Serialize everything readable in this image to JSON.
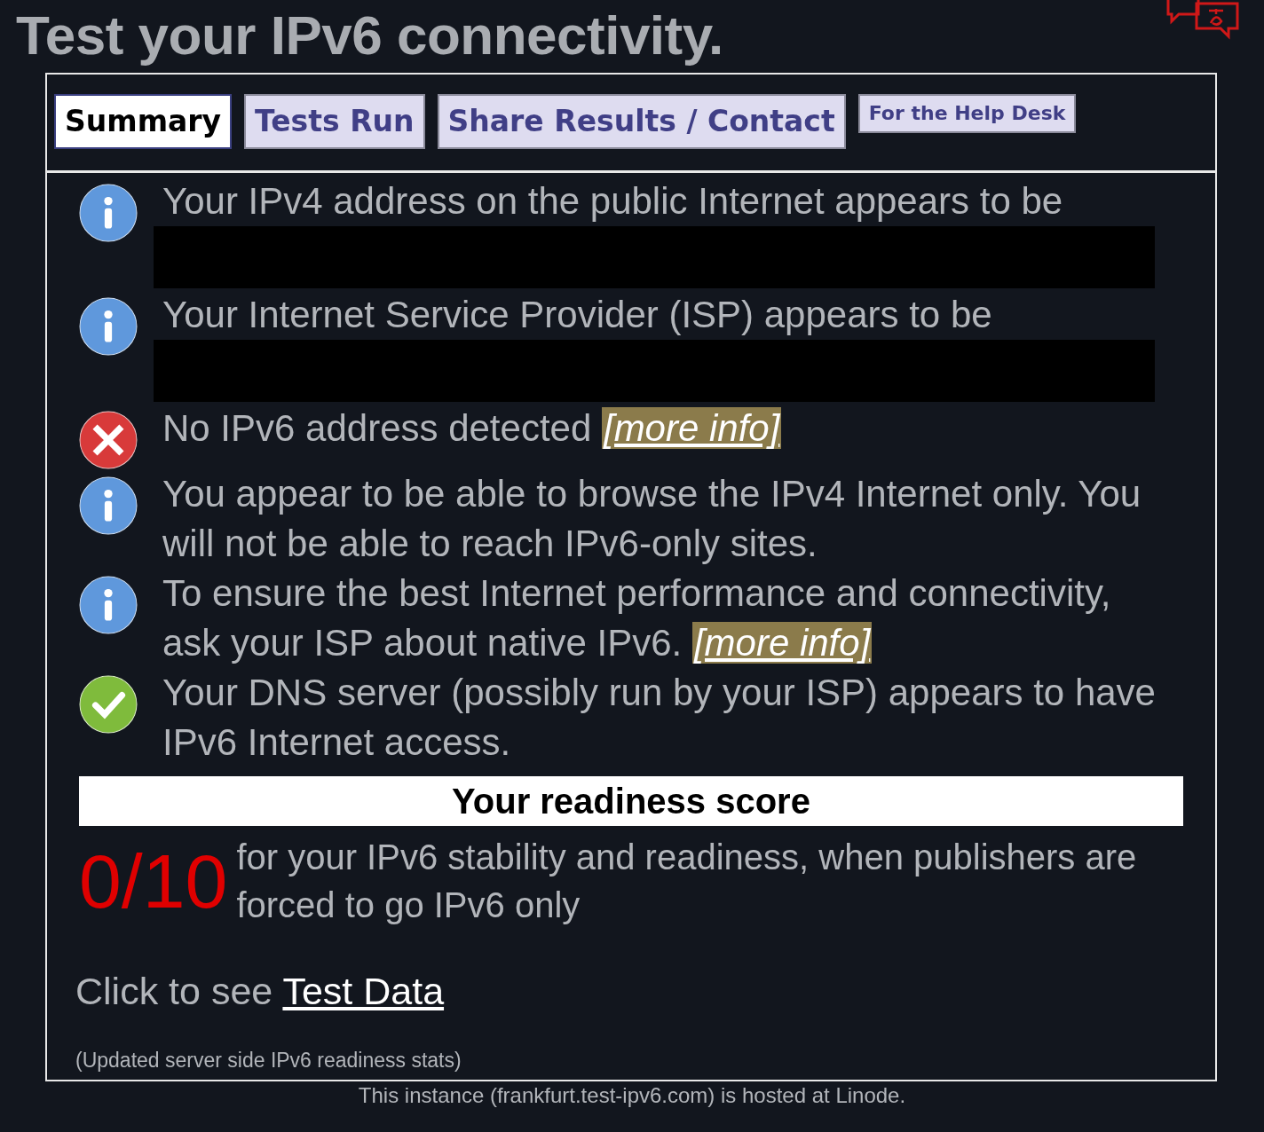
{
  "title": "Test your IPv6 connectivity.",
  "tabs": [
    {
      "label": "Summary",
      "selected": true,
      "kind": "page"
    },
    {
      "label": "Tests Run",
      "selected": false,
      "kind": "page"
    },
    {
      "label": "Share Results / Contact",
      "selected": false,
      "kind": "page"
    },
    {
      "label": "For the Help Desk",
      "selected": false,
      "kind": "helpdesk"
    }
  ],
  "messages": [
    {
      "kind": "info",
      "text": "Your IPv4 address on the public Internet appears to be",
      "redacted": true
    },
    {
      "kind": "info",
      "text": "Your Internet Service Provider (ISP) appears to be",
      "redacted": true
    },
    {
      "kind": "error",
      "text": "No IPv6 address detected",
      "link": "[more info]"
    },
    {
      "kind": "info",
      "text": "You appear to be able to browse the IPv4 Internet only. You will not be able to reach IPv6-only sites."
    },
    {
      "kind": "info",
      "text": "To ensure the best Internet performance and connectivity, ask your ISP about native IPv6.",
      "link": "[more info]"
    },
    {
      "kind": "ok",
      "text": "Your DNS server (possibly run by your ISP) appears to have IPv6 Internet access."
    }
  ],
  "score": {
    "heading": "Your readiness score",
    "value": "0/10",
    "description": "for your IPv6 stability and readiness, when publishers are forced to go IPv6 only"
  },
  "test_data": {
    "text": "Click to see",
    "link": "Test Data"
  },
  "stats_note": "(Updated server side IPv6 readiness stats)",
  "footer": "This instance (frankfurt.test-ipv6.com) is hosted at Linode."
}
